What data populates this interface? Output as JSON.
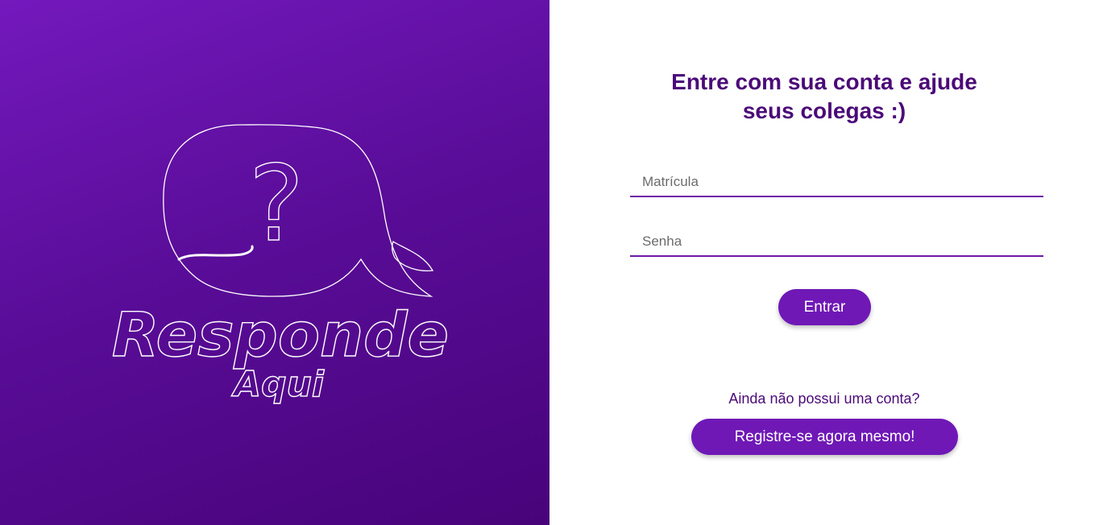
{
  "brand": {
    "logo_title": "Responde",
    "logo_subtitle": "Aqui",
    "logo_symbol": "?"
  },
  "login": {
    "heading_line1": "Entre com sua conta e ajude",
    "heading_line2": "seus colegas :)",
    "matricula_placeholder": "Matrícula",
    "senha_placeholder": "Senha",
    "entrar_label": "Entrar",
    "no_account_text": "Ainda não possui uma conta?",
    "register_label": "Registre-se agora mesmo!"
  },
  "colors": {
    "primary": "#6f18b6",
    "heading": "#4b0a78",
    "gradient_start": "#7419bd",
    "gradient_end": "#48037a"
  }
}
